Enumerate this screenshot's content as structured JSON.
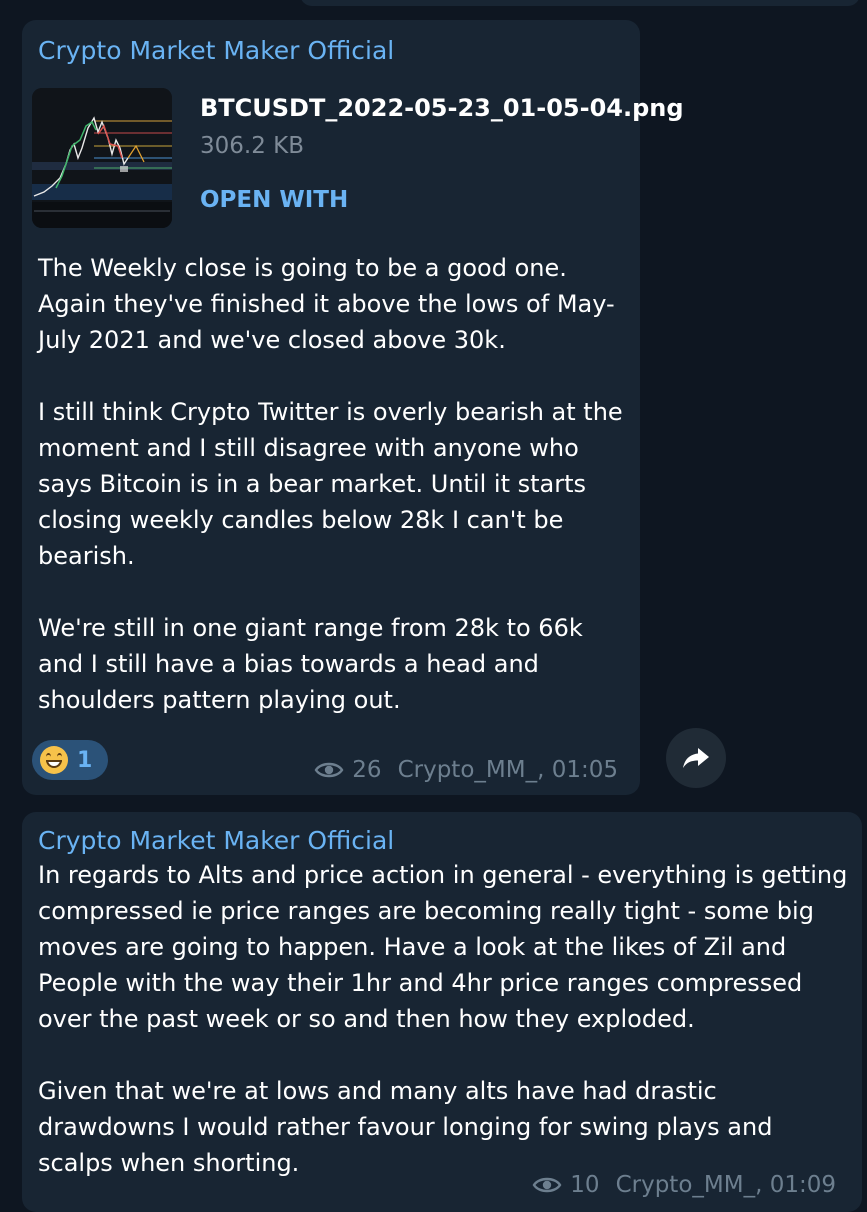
{
  "messages": [
    {
      "sender": "Crypto Market Maker Official",
      "attachment": {
        "file_name": "BTCUSDT_2022-05-23_01-05-04.png",
        "file_size": "306.2 KB",
        "action": "OPEN WITH"
      },
      "text_lines": [
        "The Weekly close is going to be a good one.",
        "Again they've finished it above the lows of May-",
        "July 2021 and we've closed above 30k.",
        "",
        "I still think Crypto Twitter is overly bearish at the",
        "moment and I still disagree with anyone who",
        "says Bitcoin is in a bear market. Until it starts",
        "closing weekly candles below 28k I can't be",
        "bearish.",
        "",
        "We're still in one giant range from 28k to 66k",
        "and I still have a bias towards a head and",
        "shoulders pattern playing out."
      ],
      "reaction": {
        "emoji": "grinning-face",
        "count": "1"
      },
      "views": "26",
      "signature": "Crypto_MM_, 01:05"
    },
    {
      "sender": "Crypto Market Maker Official",
      "text_lines": [
        "In regards to Alts and price action in general - everything is getting",
        "compressed ie price ranges are becoming really tight - some big",
        "moves are going to happen. Have a look at the likes of Zil and",
        "People with the way their 1hr and 4hr price ranges compressed",
        "over the past week or so and then how they exploded.",
        "",
        "Given that we're at lows and many alts have had drastic",
        "drawdowns I would rather favour longing for swing plays and",
        "scalps when shorting."
      ],
      "views": "10",
      "signature": "Crypto_MM_, 01:09"
    }
  ],
  "icons": {
    "views": "eye-icon",
    "forward": "share-arrow-icon"
  },
  "colors": {
    "background": "#0e1621",
    "bubble": "#182533",
    "accent": "#6ab3f3",
    "meta": "#6d7f8f"
  }
}
